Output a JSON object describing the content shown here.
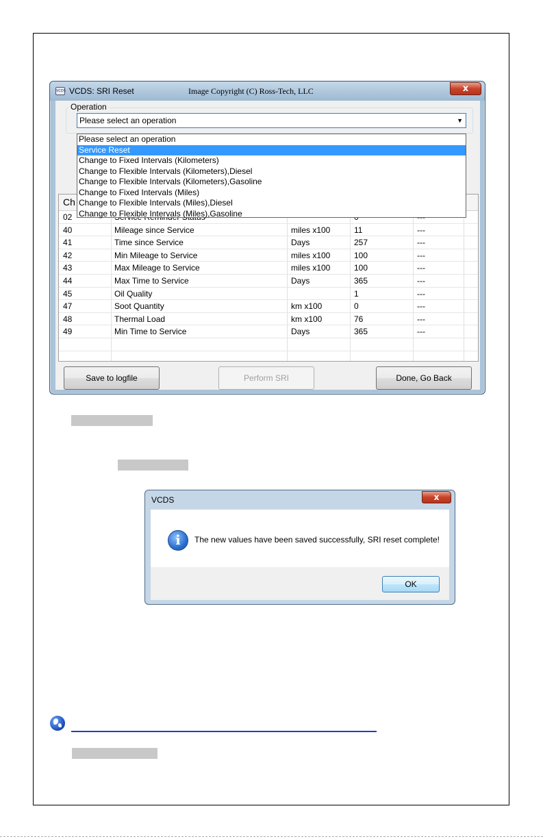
{
  "sri_window": {
    "title": "VCDS:  SRI Reset",
    "copyright": "Image Copyright (C) Ross-Tech, LLC",
    "close_label": "x",
    "app_icon_label": "VCDS",
    "operation": {
      "legend": "Operation",
      "selected": "Please select an operation",
      "options": [
        "Please select an operation",
        "Service Reset",
        "Change to Fixed Intervals (Kilometers)",
        "Change to Flexible Intervals (Kilometers),Diesel",
        "Change to Flexible Intervals (Kilometers),Gasoline",
        "Change to Fixed Intervals (Miles)",
        "Change to Flexible Intervals (Miles),Diesel",
        "Change to Flexible Intervals (Miles),Gasoline"
      ],
      "highlighted_index": 1
    },
    "table": {
      "header_partial": "Ch",
      "rows": [
        {
          "ch": "02",
          "name": "Service Reminder Status",
          "unit": "",
          "value": "0",
          "extra": "---"
        },
        {
          "ch": "40",
          "name": "Mileage since Service",
          "unit": "miles x100",
          "value": "11",
          "extra": "---"
        },
        {
          "ch": "41",
          "name": "Time since Service",
          "unit": "Days",
          "value": "257",
          "extra": "---"
        },
        {
          "ch": "42",
          "name": "Min Mileage to Service",
          "unit": "miles x100",
          "value": "100",
          "extra": "---"
        },
        {
          "ch": "43",
          "name": "Max Mileage to Service",
          "unit": "miles x100",
          "value": "100",
          "extra": "---"
        },
        {
          "ch": "44",
          "name": "Max Time to Service",
          "unit": "Days",
          "value": "365",
          "extra": "---"
        },
        {
          "ch": "45",
          "name": "Oil Quality",
          "unit": "",
          "value": "1",
          "extra": "---"
        },
        {
          "ch": "47",
          "name": "Soot Quantity",
          "unit": "km x100",
          "value": "0",
          "extra": "---"
        },
        {
          "ch": "48",
          "name": "Thermal Load",
          "unit": "km x100",
          "value": "76",
          "extra": "---"
        },
        {
          "ch": "49",
          "name": "Min Time to Service",
          "unit": "Days",
          "value": "365",
          "extra": "---"
        }
      ]
    },
    "buttons": {
      "save": "Save to logfile",
      "perform": "Perform SRI",
      "done": "Done, Go Back"
    }
  },
  "message_box": {
    "title": "VCDS",
    "close_label": "x",
    "icon_glyph": "i",
    "text": "The new values have been saved successfully, SRI reset complete!",
    "ok_label": "OK"
  }
}
